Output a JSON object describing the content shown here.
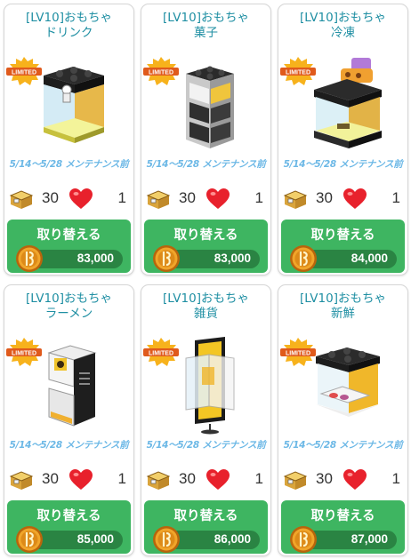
{
  "items": [
    {
      "title_line1": "[LV10]おもちゃ",
      "title_line2": "ドリンク",
      "badge": "LIMITED",
      "period": "5/14～5/28 メンテナンス前",
      "box_cost": "30",
      "heart_cost": "1",
      "button_label": "取り替える",
      "price": "83,000",
      "image_icon": "drink-toy-machine"
    },
    {
      "title_line1": "[LV10]おもちゃ",
      "title_line2": "菓子",
      "badge": "LIMITED",
      "period": "5/14～5/28 メンテナンス前",
      "box_cost": "30",
      "heart_cost": "1",
      "button_label": "取り替える",
      "price": "83,000",
      "image_icon": "snack-toy-shelf"
    },
    {
      "title_line1": "[LV10]おもちゃ",
      "title_line2": "冷凍",
      "badge": "LIMITED",
      "period": "5/14～5/28 メンテナンス前",
      "box_cost": "30",
      "heart_cost": "1",
      "button_label": "取り替える",
      "price": "84,000",
      "image_icon": "frozen-toy-case"
    },
    {
      "title_line1": "[LV10]おもちゃ",
      "title_line2": "ラーメン",
      "badge": "LIMITED",
      "period": "5/14～5/28 メンテナンス前",
      "box_cost": "30",
      "heart_cost": "1",
      "button_label": "取り替える",
      "price": "85,000",
      "image_icon": "ramen-toy-booth"
    },
    {
      "title_line1": "[LV10]おもちゃ",
      "title_line2": "雑貨",
      "badge": "LIMITED",
      "period": "5/14～5/28 メンテナンス前",
      "box_cost": "30",
      "heart_cost": "1",
      "button_label": "取り替える",
      "price": "86,000",
      "image_icon": "goods-toy-stand"
    },
    {
      "title_line1": "[LV10]おもちゃ",
      "title_line2": "新鮮",
      "badge": "LIMITED",
      "period": "5/14～5/28 メンテナンス前",
      "box_cost": "30",
      "heart_cost": "1",
      "button_label": "取り替える",
      "price": "87,000",
      "image_icon": "fresh-toy-machine"
    }
  ],
  "colors": {
    "title": "#1f8fa3",
    "button": "#3eb561",
    "price_bar": "#2a8443",
    "period": "#6cb8e6"
  }
}
